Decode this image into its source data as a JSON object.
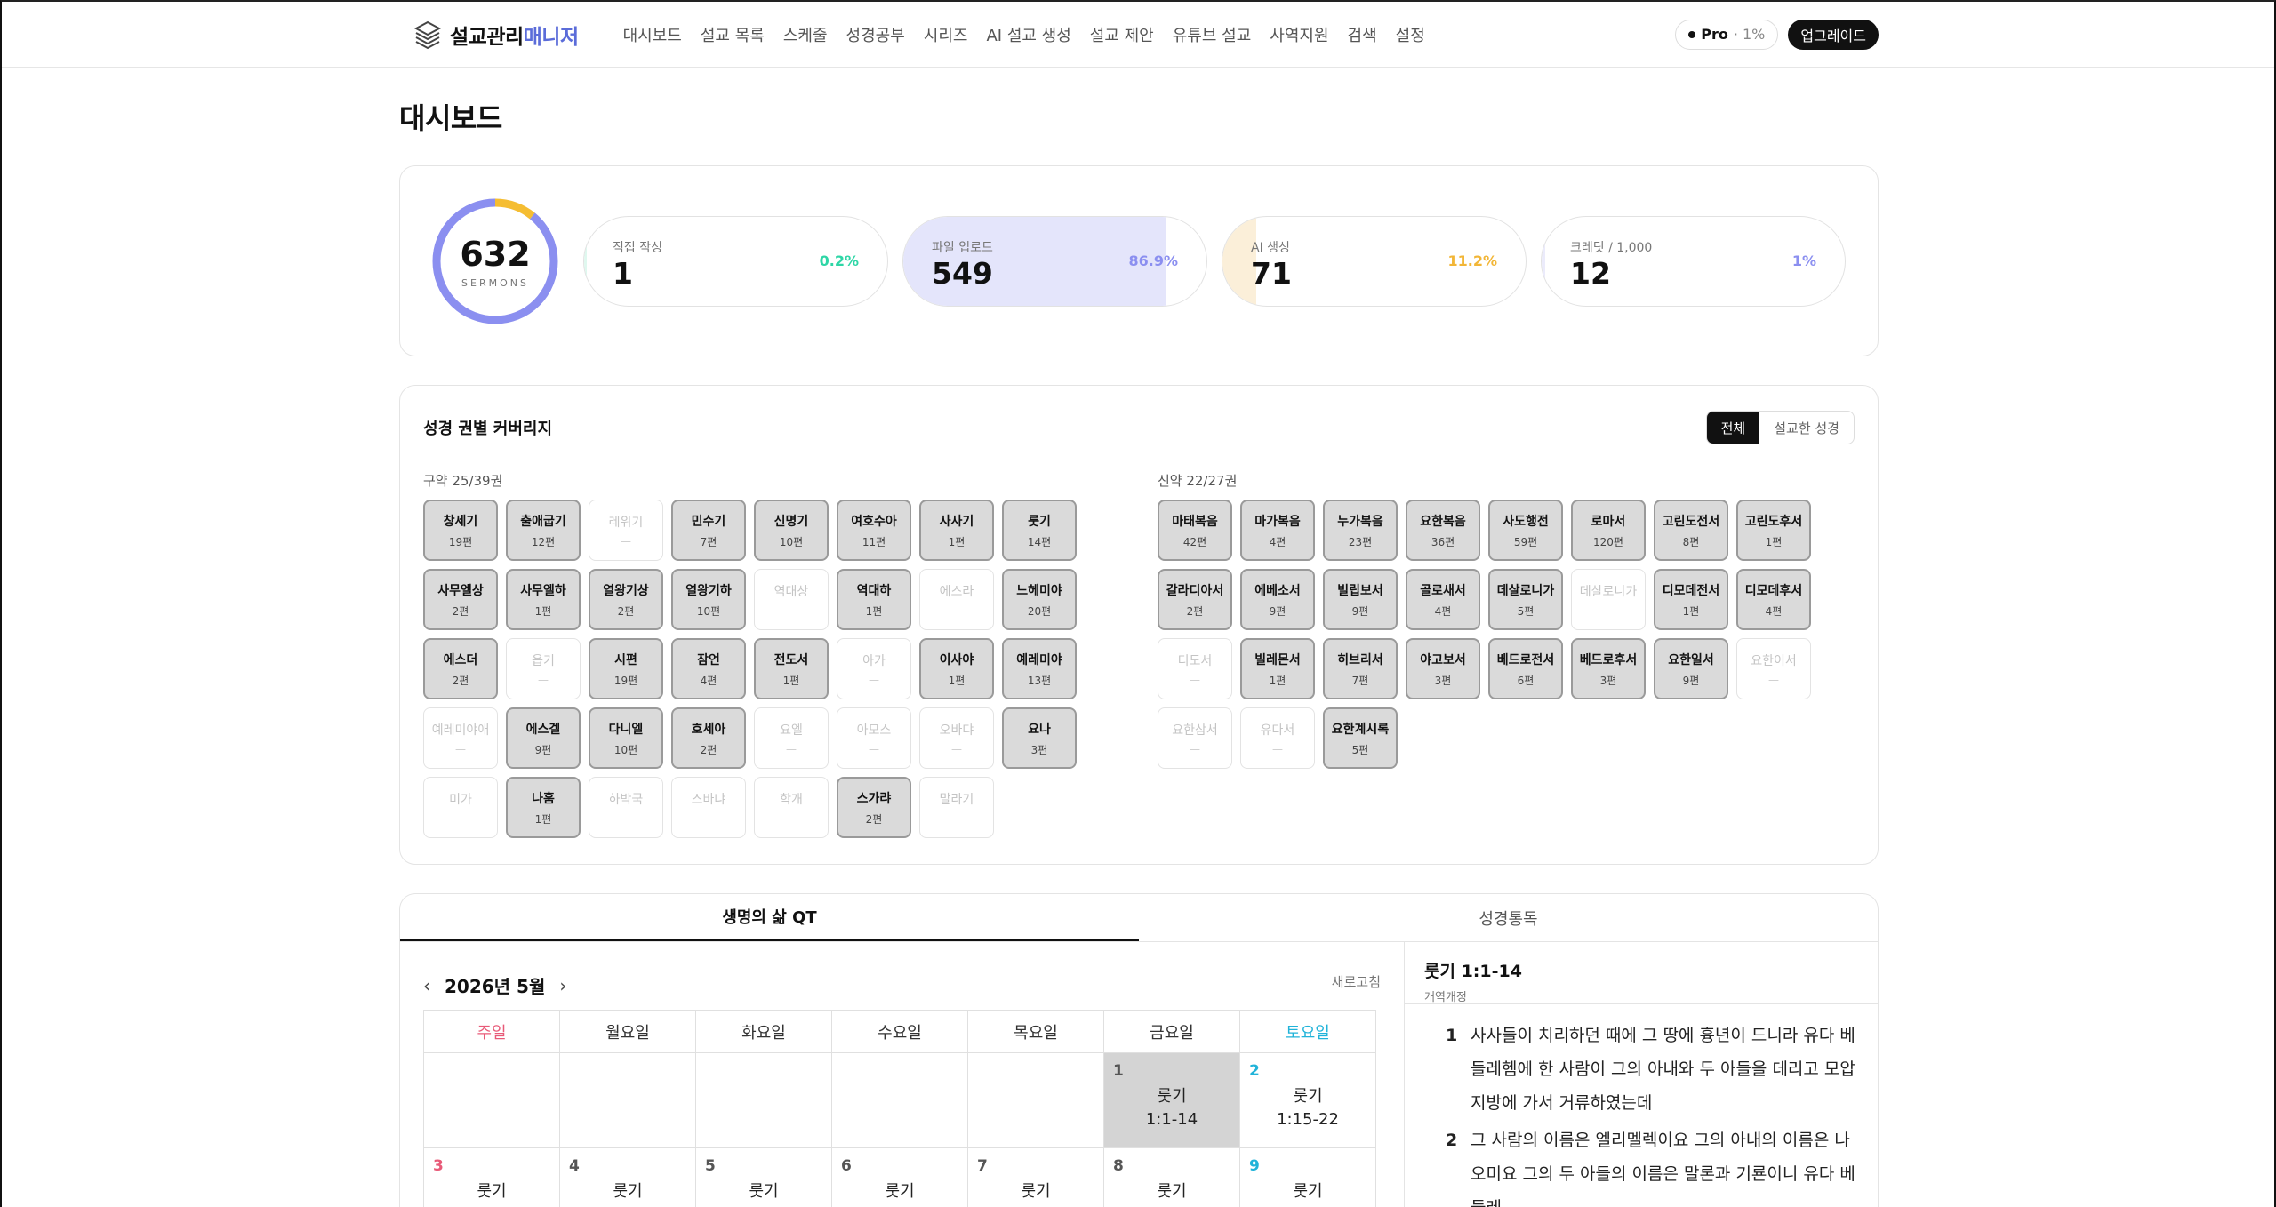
{
  "app": {
    "logo_prefix": "설교관리",
    "logo_accent": "매니저"
  },
  "nav": [
    {
      "label": "대시보드"
    },
    {
      "label": "설교 목록"
    },
    {
      "label": "스케줄"
    },
    {
      "label": "성경공부"
    },
    {
      "label": "시리즈"
    },
    {
      "label": "AI 설교 생성"
    },
    {
      "label": "설교 제안"
    },
    {
      "label": "유튜브 설교"
    },
    {
      "label": "사역지원"
    },
    {
      "label": "검색"
    },
    {
      "label": "설정"
    }
  ],
  "plan": {
    "name": "Pro",
    "pct": "· 1%"
  },
  "upgrade_label": "업그레이드",
  "page_title": "대시보드",
  "summary": {
    "total": "632",
    "total_label": "SERMONS",
    "donut_share": {
      "blue": 0.891,
      "yellow": 0.109
    }
  },
  "stats": [
    {
      "label": "직접 작성",
      "value": "1",
      "pct": "0.2%",
      "fill": 0.002,
      "color": "#2ed6a6",
      "fill_color": "#dff8ef"
    },
    {
      "label": "파일 업로드",
      "value": "549",
      "pct": "86.9%",
      "fill": 0.869,
      "color": "#8b8ff0",
      "fill_color": "#e4e5fb"
    },
    {
      "label": "AI 생성",
      "value": "71",
      "pct": "11.2%",
      "fill": 0.112,
      "color": "#f2b637",
      "fill_color": "#fbefd9"
    },
    {
      "label": "크레딧 / 1,000",
      "value": "12",
      "pct": "1%",
      "fill": 0.012,
      "color": "#8b8ff0",
      "fill_color": "#ebebfb"
    }
  ],
  "coverage": {
    "title": "성경 권별 커버리지",
    "toggle": {
      "all": "전체",
      "preached": "설교한 성경"
    },
    "ot_label": "구약 25/39권",
    "nt_label": "신약 22/27권",
    "old_testament": [
      {
        "name": "창세기",
        "count": "19편"
      },
      {
        "name": "출애굽기",
        "count": "12편"
      },
      {
        "name": "레위기",
        "count": "—",
        "empty": true
      },
      {
        "name": "민수기",
        "count": "7편"
      },
      {
        "name": "신명기",
        "count": "10편"
      },
      {
        "name": "여호수아",
        "count": "11편"
      },
      {
        "name": "사사기",
        "count": "1편"
      },
      {
        "name": "룻기",
        "count": "14편"
      },
      {
        "name": "사무엘상",
        "count": "2편"
      },
      {
        "name": "사무엘하",
        "count": "1편"
      },
      {
        "name": "열왕기상",
        "count": "2편"
      },
      {
        "name": "열왕기하",
        "count": "10편"
      },
      {
        "name": "역대상",
        "count": "—",
        "empty": true
      },
      {
        "name": "역대하",
        "count": "1편"
      },
      {
        "name": "에스라",
        "count": "—",
        "empty": true
      },
      {
        "name": "느헤미야",
        "count": "20편"
      },
      {
        "name": "에스더",
        "count": "2편"
      },
      {
        "name": "욥기",
        "count": "—",
        "empty": true
      },
      {
        "name": "시편",
        "count": "19편"
      },
      {
        "name": "잠언",
        "count": "4편"
      },
      {
        "name": "전도서",
        "count": "1편"
      },
      {
        "name": "아가",
        "count": "—",
        "empty": true
      },
      {
        "name": "이사야",
        "count": "1편"
      },
      {
        "name": "예레미야",
        "count": "13편"
      },
      {
        "name": "예레미야애",
        "count": "—",
        "empty": true
      },
      {
        "name": "에스겔",
        "count": "9편"
      },
      {
        "name": "다니엘",
        "count": "10편"
      },
      {
        "name": "호세아",
        "count": "2편"
      },
      {
        "name": "요엘",
        "count": "—",
        "empty": true
      },
      {
        "name": "아모스",
        "count": "—",
        "empty": true
      },
      {
        "name": "오바댜",
        "count": "—",
        "empty": true
      },
      {
        "name": "요나",
        "count": "3편"
      },
      {
        "name": "미가",
        "count": "—",
        "empty": true
      },
      {
        "name": "나훔",
        "count": "1편"
      },
      {
        "name": "하박국",
        "count": "—",
        "empty": true
      },
      {
        "name": "스바냐",
        "count": "—",
        "empty": true
      },
      {
        "name": "학개",
        "count": "—",
        "empty": true
      },
      {
        "name": "스가랴",
        "count": "2편"
      },
      {
        "name": "말라기",
        "count": "—",
        "empty": true
      }
    ],
    "new_testament": [
      {
        "name": "마태복음",
        "count": "42편"
      },
      {
        "name": "마가복음",
        "count": "4편"
      },
      {
        "name": "누가복음",
        "count": "23편"
      },
      {
        "name": "요한복음",
        "count": "36편"
      },
      {
        "name": "사도행전",
        "count": "59편"
      },
      {
        "name": "로마서",
        "count": "120편"
      },
      {
        "name": "고린도전서",
        "count": "8편"
      },
      {
        "name": "고린도후서",
        "count": "1편"
      },
      {
        "name": "갈라디아서",
        "count": "2편"
      },
      {
        "name": "에베소서",
        "count": "9편"
      },
      {
        "name": "빌립보서",
        "count": "9편"
      },
      {
        "name": "골로새서",
        "count": "4편"
      },
      {
        "name": "데살로니가",
        "count": "5편"
      },
      {
        "name": "데살로니가",
        "count": "—",
        "empty": true
      },
      {
        "name": "디모데전서",
        "count": "1편"
      },
      {
        "name": "디모데후서",
        "count": "4편"
      },
      {
        "name": "디도서",
        "count": "—",
        "empty": true
      },
      {
        "name": "빌레몬서",
        "count": "1편"
      },
      {
        "name": "히브리서",
        "count": "7편"
      },
      {
        "name": "야고보서",
        "count": "3편"
      },
      {
        "name": "베드로전서",
        "count": "6편"
      },
      {
        "name": "베드로후서",
        "count": "3편"
      },
      {
        "name": "요한일서",
        "count": "9편"
      },
      {
        "name": "요한이서",
        "count": "—",
        "empty": true
      },
      {
        "name": "요한삼서",
        "count": "—",
        "empty": true
      },
      {
        "name": "유다서",
        "count": "—",
        "empty": true
      },
      {
        "name": "요한계시록",
        "count": "5편"
      }
    ]
  },
  "qt": {
    "tabs": [
      "생명의 삶 QT",
      "성경통독"
    ],
    "month": "2026년 5월",
    "prev": "‹",
    "next": "›",
    "refresh": "새로고침",
    "weekdays": [
      "주일",
      "월요일",
      "화요일",
      "수요일",
      "목요일",
      "금요일",
      "토요일"
    ],
    "week1": [
      {
        "day": "",
        "reading": ""
      },
      {
        "day": "",
        "reading": ""
      },
      {
        "day": "",
        "reading": ""
      },
      {
        "day": "",
        "reading": ""
      },
      {
        "day": "",
        "reading": ""
      },
      {
        "day": "1",
        "reading": "룻기\n1:1-14",
        "today": true
      },
      {
        "day": "2",
        "reading": "룻기\n1:15-22"
      }
    ],
    "week2": [
      {
        "day": "3",
        "reading": "룻기"
      },
      {
        "day": "4",
        "reading": "룻기"
      },
      {
        "day": "5",
        "reading": "룻기"
      },
      {
        "day": "6",
        "reading": "룻기"
      },
      {
        "day": "7",
        "reading": "룻기"
      },
      {
        "day": "8",
        "reading": "룻기"
      },
      {
        "day": "9",
        "reading": "룻기"
      }
    ],
    "passage": {
      "ref": "룻기 1:1-14",
      "version": "개역개정",
      "verses": [
        {
          "n": "1",
          "text": "사사들이 치리하던 때에 그 땅에 흉년이 드니라 유다 베들레헴에 한 사람이 그의 아내와 두 아들을 데리고 모압 지방에 가서 거류하였는데"
        },
        {
          "n": "2",
          "text": "그 사람의 이름은 엘리멜렉이요 그의 아내의 이름은 나오미요 그의 두 아들의 이름은 말론과 기룐이니 유다 베들레"
        }
      ]
    }
  }
}
